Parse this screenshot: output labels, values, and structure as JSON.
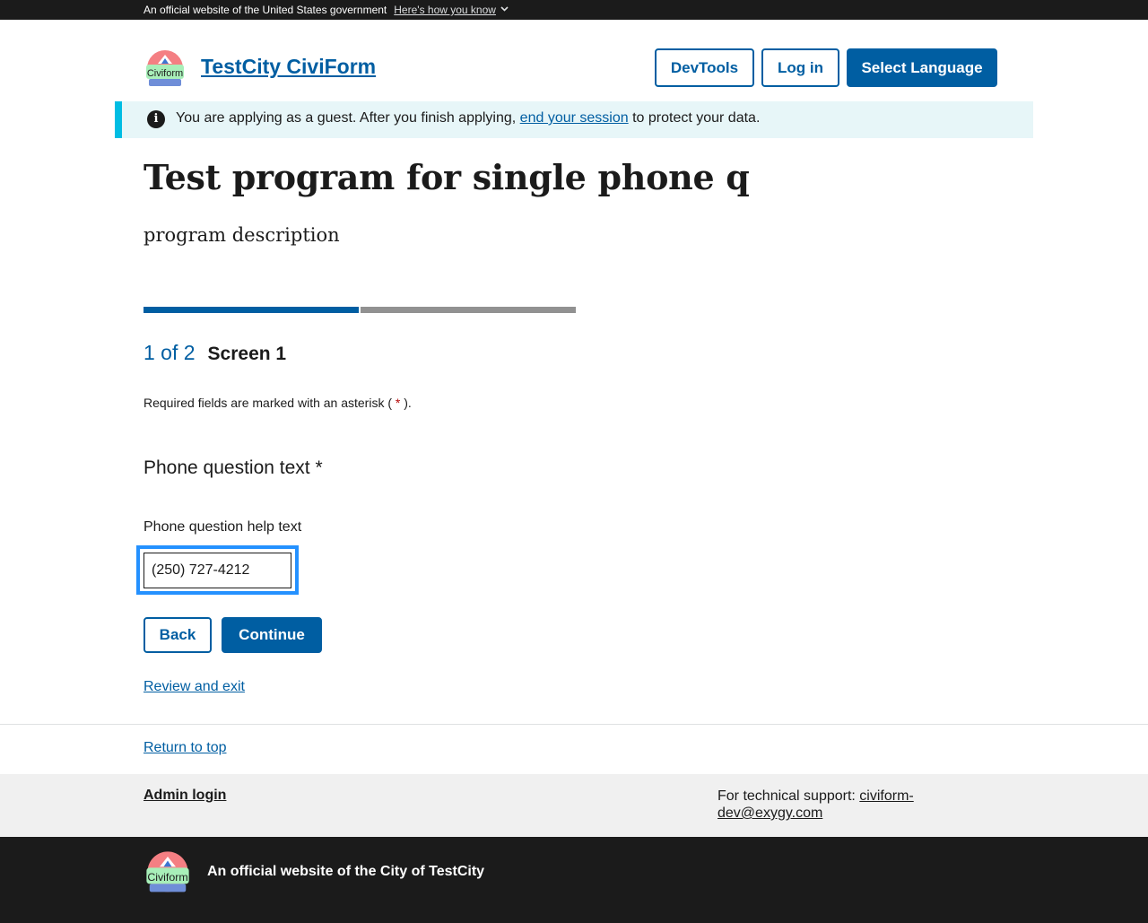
{
  "gov_banner": {
    "text": "An official website of the United States government",
    "link": "Here's how you know",
    "chevron": "⌄"
  },
  "header": {
    "logo_text": "Civiform",
    "site_title": "TestCity CiviForm",
    "buttons": {
      "devtools": "DevTools",
      "login": "Log in",
      "language": "Select Language"
    }
  },
  "alert": {
    "icon": "info-icon",
    "text_before": "You are applying as a guest. After you finish applying, ",
    "link": "end your session",
    "text_after": " to protect your data."
  },
  "program": {
    "title": "Test program for single phone q",
    "description": "program description"
  },
  "progress": {
    "current": 1,
    "total": 2,
    "count_label": "1 of 2",
    "screen_name": "Screen 1"
  },
  "required_note": {
    "before": "Required fields are marked with an asterisk ( ",
    "asterisk": "*",
    "after": " )."
  },
  "question": {
    "text": "Phone question text *",
    "help": "Phone question help text",
    "value": "(250) 727-4212"
  },
  "actions": {
    "back": "Back",
    "continue": "Continue",
    "review": "Review and exit"
  },
  "footer": {
    "return_top": "Return to top",
    "admin_login": "Admin login",
    "support_label": "For technical support: ",
    "support_email": "civiform-dev@exygy.com",
    "official": "An official website of the City of TestCity",
    "logo_text": "Civiform"
  },
  "colors": {
    "primary": "#005ea2",
    "alert_bg": "#e7f6f8",
    "alert_border": "#00bde3",
    "focus": "#2491ff",
    "dark": "#1b1b1b"
  }
}
